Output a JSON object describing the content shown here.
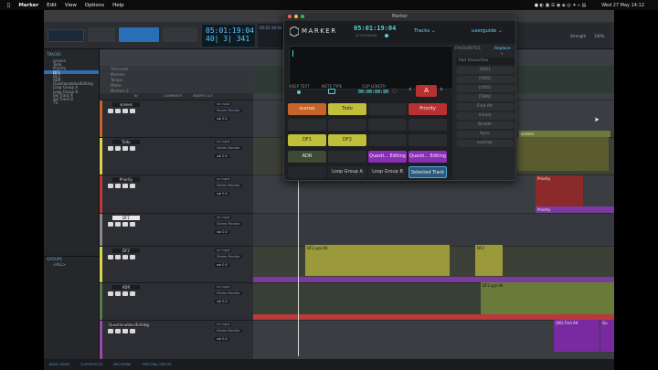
{
  "menubar": {
    "app": "Marker",
    "items": [
      "Edit",
      "View",
      "Options",
      "Help"
    ],
    "datetime": "Wed 27 May  14:12"
  },
  "protools": {
    "counter_main": "05:01:19:04",
    "counter_sub": "40| 3| 341",
    "counter_small": "05:01:19:04",
    "tracks_label": "TRACKS",
    "groups_label": "GROUPS",
    "group_all": "<ALL>",
    "tracks": [
      "scenes",
      "Todo",
      "Priority",
      "DF1",
      "DF2",
      "ADR",
      "Questionables/Editing",
      "Loop Group A",
      "Loop Group B",
      "Sel Track A",
      "Sel Track B",
      "TV"
    ],
    "selected_track_index": 3,
    "ruler_rows": [
      "Timecode",
      "Markers",
      "Tempo",
      "Meter",
      "Markers 2"
    ],
    "mixer_headers": [
      "IN",
      "COMMENTS",
      "INSERTS A-E"
    ],
    "track_lanes": [
      {
        "name": "scenes",
        "color": "#c8642a"
      },
      {
        "name": "Todo",
        "color": "#d8d84a"
      },
      {
        "name": "Priority",
        "color": "#c43a3a"
      },
      {
        "name": "DF1",
        "color": "#8a8a8a"
      },
      {
        "name": "DF2",
        "color": "#d8d84a"
      },
      {
        "name": "ADR",
        "color": "#5a7a4a"
      },
      {
        "name": "Questionables/Editing",
        "color": "#9a4ab0"
      }
    ],
    "io_labels": [
      "no input",
      "Stereo Monitor"
    ],
    "fader_values": [
      "vol 0.0",
      "pan 0"
    ],
    "clips": {
      "scenes": "scenes",
      "priority": "Priority",
      "priority_marker": "Priority",
      "df2_1": "DF2.grp-06",
      "df2_2": "DF2",
      "adr": "DF2.grp-06",
      "quest": "(06) Find Alt",
      "quest2": "Qu"
    },
    "bottom_bar": [
      "BASIC MODE",
      "CLIP EFFECTS",
      "MELODYNE",
      "SPECTRAL EDITOR"
    ],
    "zoom_readout": "Strength",
    "percent": "100%"
  },
  "marker": {
    "window_title": "Marker",
    "brand": "MARKER",
    "timecode": "05:01:19:04",
    "timecode_sub": "AT PLAYHEAD",
    "tracks_dropdown": "Tracks",
    "user_dropdown": "userguide",
    "keep_text_label": "KEEP TEXT",
    "note_type_label": "NOTE TYPE",
    "clip_length_label": "CLIP LENGTH",
    "clip_length_value": "00:00:00:00",
    "note_letter": "A",
    "favourites_title": "FAVOURITES",
    "replace_label": "Replace",
    "add_favourites_placeholder": "Add favourites",
    "favourites": [
      "[ISO]",
      "[VOS]",
      "[VOS]",
      "[TBW]",
      "Find Alt",
      "Inhale",
      "Breath",
      "Sync",
      "overlap"
    ],
    "buttons": [
      {
        "label": "scenes",
        "color": "#c8642a"
      },
      {
        "label": "Todo",
        "color": "#c4c43a"
      },
      {
        "label": "",
        "color": "#2a2c30"
      },
      {
        "label": "Priority",
        "color": "#b83030"
      },
      {
        "label": "",
        "color": "#2a2c30"
      },
      {
        "label": "",
        "color": "#2a2c30"
      },
      {
        "label": "",
        "color": "#2a2c30"
      },
      {
        "label": "",
        "color": "#2a2c30"
      },
      {
        "label": "DF1",
        "color": "#c4c43a"
      },
      {
        "label": "DF2",
        "color": "#c4c43a"
      },
      {
        "label": "",
        "color": "#2a2c30"
      },
      {
        "label": "",
        "color": "#2a2c30"
      },
      {
        "label": "ADR",
        "color": "#3e4a34"
      },
      {
        "label": "",
        "color": "#2a2c30"
      },
      {
        "label": "Questi... Editing",
        "color": "#8a2eb8"
      },
      {
        "label": "Questi... Editing",
        "color": "#8a2eb8"
      },
      {
        "label": "",
        "color": "#24262a"
      },
      {
        "label": "Loop Group A",
        "color": "#24262a"
      },
      {
        "label": "Loop Group B",
        "color": "#24262a"
      },
      {
        "label": "Selected Track",
        "color": "#2d5a7a"
      }
    ]
  }
}
